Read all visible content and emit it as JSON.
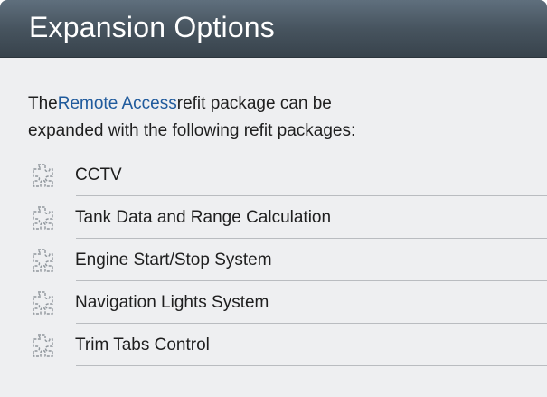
{
  "header": {
    "title": "Expansion Options"
  },
  "intro": {
    "prefix": "The",
    "link_text": "Remote Access",
    "suffix_line1": "refit package can be",
    "line2": "expanded with the following refit packages:"
  },
  "options": [
    {
      "label": "CCTV",
      "icon": "puzzle-icon"
    },
    {
      "label": "Tank Data and Range Calculation",
      "icon": "puzzle-icon"
    },
    {
      "label": "Engine Start/Stop System",
      "icon": "puzzle-icon"
    },
    {
      "label": "Navigation Lights System",
      "icon": "puzzle-icon"
    },
    {
      "label": "Trim Tabs Control",
      "icon": "puzzle-icon"
    }
  ],
  "colors": {
    "header_bg": "#47545f",
    "panel_bg": "#eeeff1",
    "link": "#1f5a9c",
    "divider": "#b9bcc0"
  }
}
